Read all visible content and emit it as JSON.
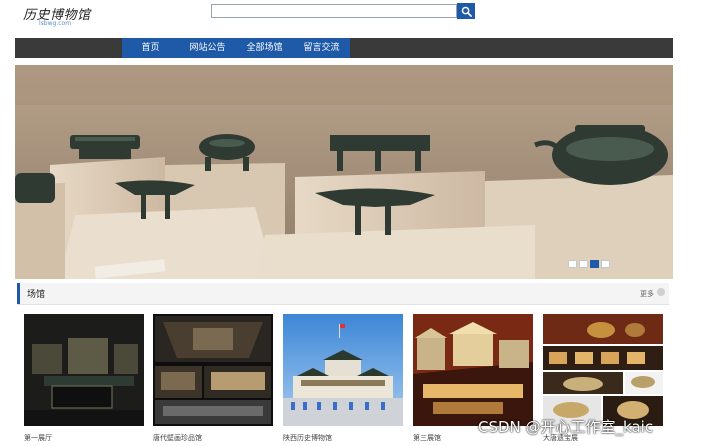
{
  "header": {
    "logo_title": "历史博物馆",
    "logo_sub": "lsbwg.com",
    "search": {
      "value": "",
      "placeholder": ""
    }
  },
  "nav": {
    "items": [
      {
        "label": "首页"
      },
      {
        "label": "网站公告"
      },
      {
        "label": "全部场馆"
      },
      {
        "label": "留言交流"
      }
    ]
  },
  "banner": {
    "slides_total": 4,
    "active_slide": 3
  },
  "section": {
    "title": "场馆",
    "more": "更多"
  },
  "venues": [
    {
      "name": "第一展厅"
    },
    {
      "name": "唐代壁画珍品馆"
    },
    {
      "name": "陕西历史博物馆"
    },
    {
      "name": "第三展馆"
    },
    {
      "name": "大唐遗宝展"
    }
  ],
  "watermark": "CSDN @开心工作室_kaic",
  "colors": {
    "accent": "#1e5aa8",
    "nav_bg": "#3a3a3a"
  }
}
